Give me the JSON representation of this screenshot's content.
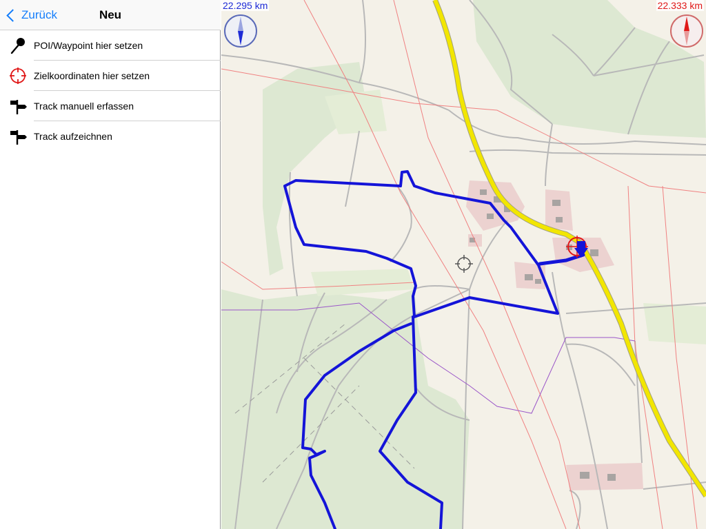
{
  "nav": {
    "back_label": "Zurück",
    "title": "Neu"
  },
  "menu": {
    "items": [
      {
        "label": "POI/Waypoint hier setzen",
        "icon": "pin-icon"
      },
      {
        "label": "Zielkoordinaten hier setzen",
        "icon": "crosshair-target-icon"
      },
      {
        "label": "Track manuell erfassen",
        "icon": "signpost-icon"
      },
      {
        "label": "Track aufzeichnen",
        "icon": "signpost-icon"
      }
    ]
  },
  "map": {
    "distance_left": "22.295 km",
    "distance_right": "22.333 km",
    "colors": {
      "track": "#1414d8",
      "main_road": "#f2e600",
      "forest": "#dde8d2",
      "meadow": "#e4edd6",
      "settlement": "#ecd2d0",
      "background": "#f4f1e8"
    }
  }
}
